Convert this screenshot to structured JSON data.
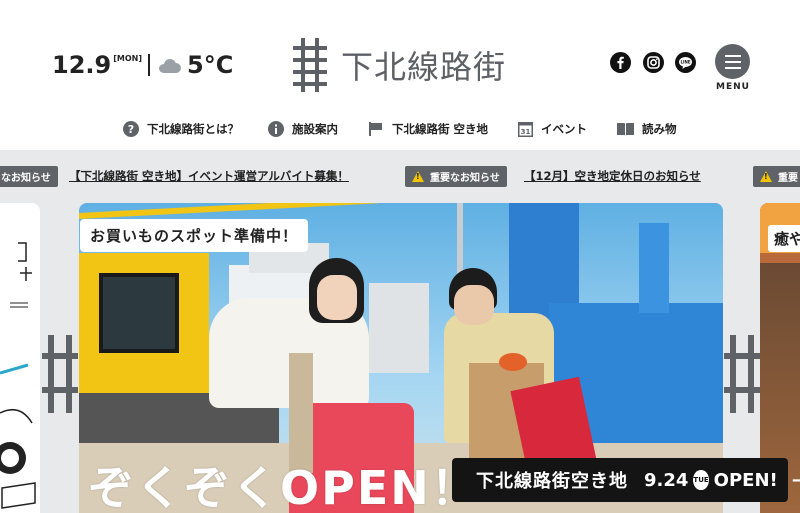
{
  "weather": {
    "date": "12.9",
    "day": "[MON]",
    "icon": "cloud-icon",
    "temperature": "5°C"
  },
  "logo": {
    "text": "下北線路街",
    "icon": "railway-hash-logo-icon"
  },
  "social": [
    {
      "name": "facebook",
      "icon": "facebook-icon"
    },
    {
      "name": "instagram",
      "icon": "instagram-icon"
    },
    {
      "name": "line",
      "icon": "line-icon"
    }
  ],
  "menu": {
    "label": "MENU",
    "icon": "hamburger-icon"
  },
  "nav": [
    {
      "label": "下北線路街とは？",
      "icon": "question-icon"
    },
    {
      "label": "施設案内",
      "icon": "info-icon"
    },
    {
      "label": "下北線路街 空き地",
      "icon": "flag-icon"
    },
    {
      "label": "イベント",
      "icon": "calendar-icon",
      "icon_text": "31"
    },
    {
      "label": "読み物",
      "icon": "book-icon"
    }
  ],
  "ticker": {
    "badge": "重要なお知らせ",
    "badge_cut_left": "なお知らせ",
    "badge_cut_right": "重要",
    "items": [
      "【下北線路街 空き地】イベント運営アルバイト募集！",
      "【12月】空き地定休日のお知らせ"
    ]
  },
  "hero": {
    "catch": "お買いものスポット準備中！",
    "headline": "ぞくぞくOPEN！",
    "cta_title": "下北線路街空き地",
    "cta_date": "9.24",
    "cta_dow": "TUE",
    "cta_open": "OPEN!",
    "cta_arrow": "→"
  },
  "side_right_text": "癒や",
  "colors": {
    "badge_bg": "#5f6368",
    "warn": "#f3c400",
    "band_bg": "#e8e9ea",
    "cta_bg": "#141414"
  }
}
